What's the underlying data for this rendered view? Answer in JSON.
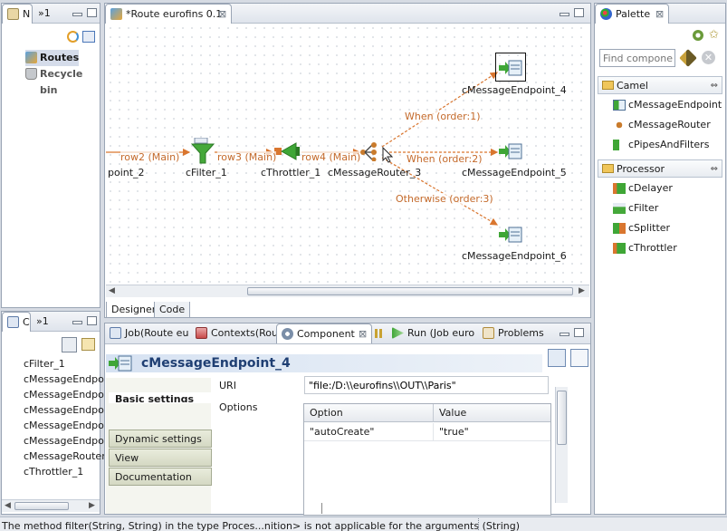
{
  "navigator": {
    "tab_label": "N",
    "tab2_label": "»1",
    "items": [
      {
        "label": "Routes",
        "icon": "routes-icon"
      },
      {
        "label": "Recycle bin",
        "icon": "recycle-bin-icon"
      }
    ]
  },
  "outline": {
    "tab_label": "C",
    "tab2_label": "»1",
    "items": [
      "cFilter_1",
      "cMessageEndpo",
      "cMessageEndpo",
      "cMessageEndpo",
      "cMessageEndpo",
      "cMessageEndpo",
      "cMessageRouter",
      "cThrottler_1"
    ]
  },
  "editor": {
    "tab_label": "*Route eurofins 0.1",
    "tab_close": "⊠",
    "bottom_tabs": [
      "Designer",
      "Code"
    ],
    "nodes": {
      "endpoint2": "point_2",
      "filter": "cFilter_1",
      "throttler": "cThrottler_1",
      "router": "cMessageRouter_3",
      "endpoint4": "cMessageEndpoint_4",
      "endpoint5": "cMessageEndpoint_5",
      "endpoint6": "cMessageEndpoint_6"
    },
    "links": {
      "row2": "row2 (Main)",
      "row3": "row3 (Main)",
      "row4": "row4 (Main)",
      "when1": "When (order:1)",
      "when2": "When (order:2)",
      "otherwise": "Otherwise (order:3)"
    }
  },
  "palette": {
    "tab_label": "Palette",
    "find_placeholder": "Find compone",
    "sections": [
      {
        "label": "Camel",
        "items": [
          "cMessageEndpoint",
          "cMessageRouter",
          "cPipesAndFilters"
        ]
      },
      {
        "label": "Processor",
        "items": [
          "cDelayer",
          "cFilter",
          "cSplitter",
          "cThrottler"
        ]
      }
    ]
  },
  "bottom_panel": {
    "tabs": [
      "Job(Route eu",
      "Contexts(Rou",
      "Component",
      "Run (Job euro",
      "Problems"
    ],
    "component_title": "cMessageEndpoint_4",
    "side_tabs": [
      "Basic settings",
      "Dynamic settings",
      "View",
      "Documentation"
    ],
    "uri_label": "URI",
    "uri_value": "\"file:/D:\\\\eurofins\\\\OUT\\\\Paris\"",
    "options_label": "Options",
    "table_headers": [
      "Option",
      "Value"
    ],
    "table_rows": [
      {
        "option": "\"autoCreate\"",
        "value": "\"true\""
      }
    ]
  },
  "status_bar": {
    "message": "The method filter(String, String) in the type Proces...nition> is not applicable for the arguments (String)"
  },
  "colors": {
    "link": "#d9762f",
    "link_text": "#c46a2b",
    "accent": "#1f3f73",
    "node_green": "#3fa636"
  }
}
